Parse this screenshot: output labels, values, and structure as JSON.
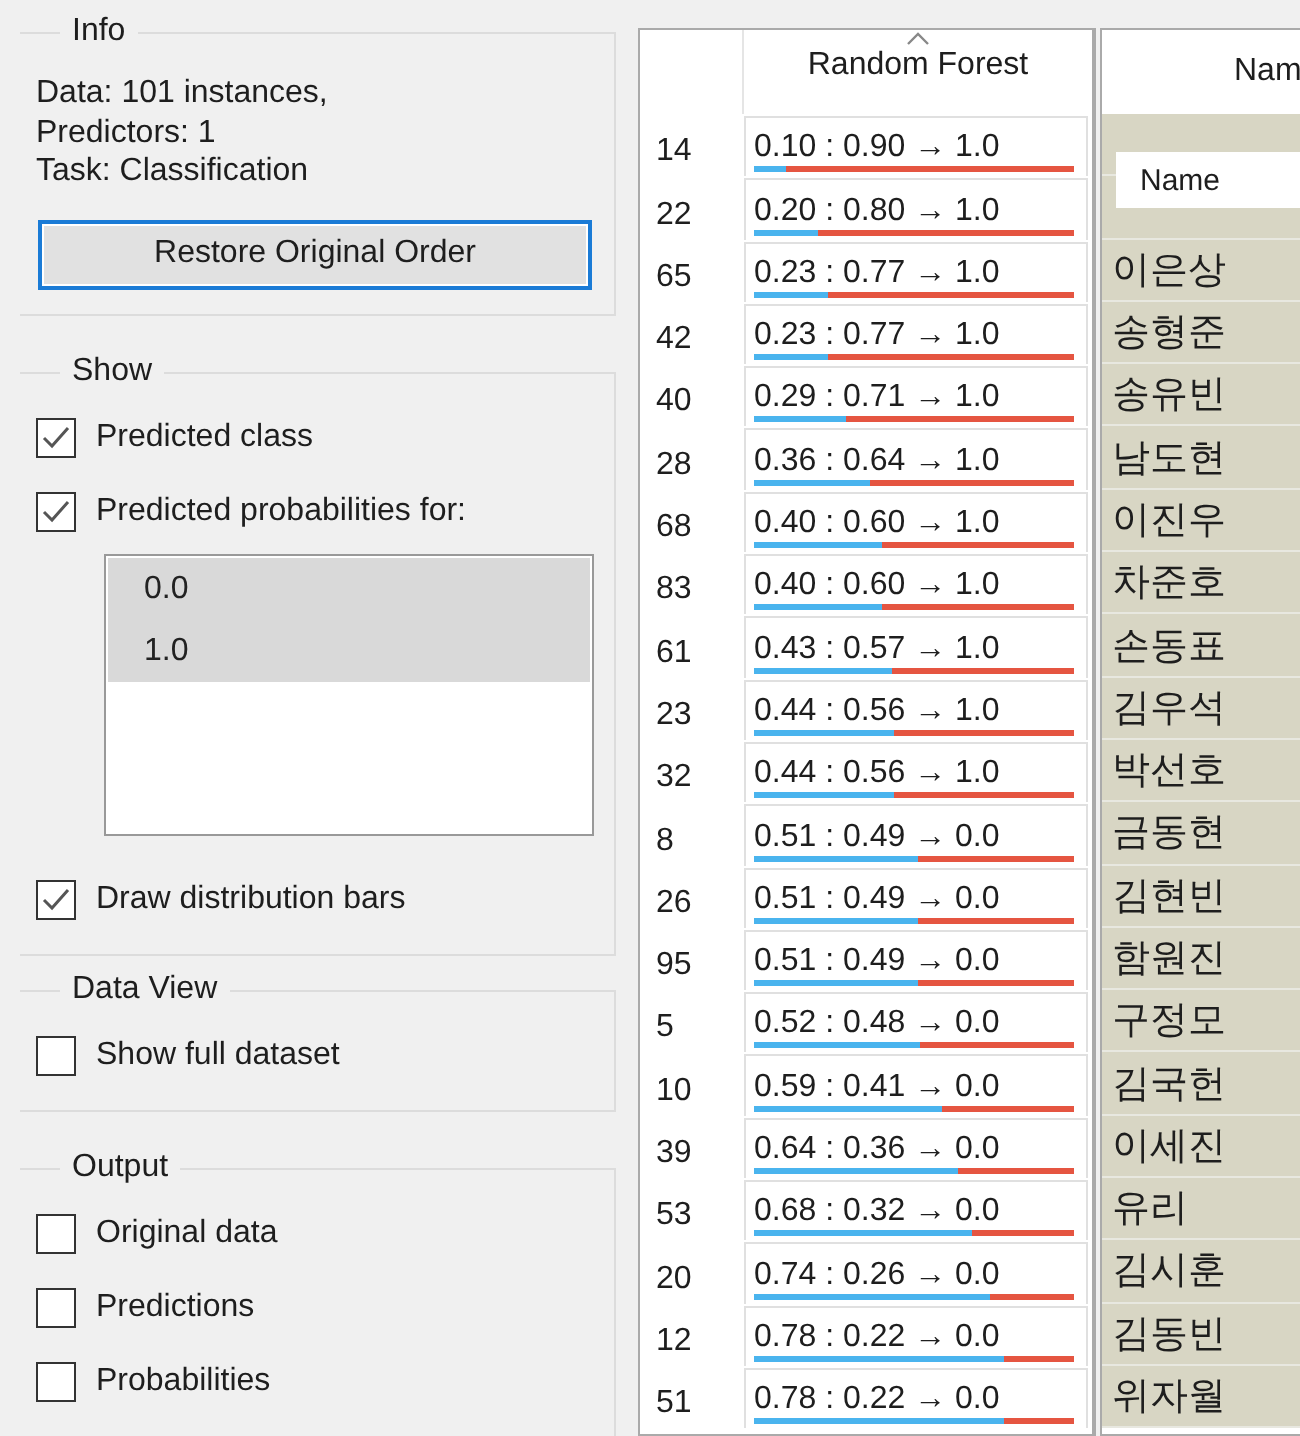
{
  "info": {
    "title": "Info",
    "lines": [
      "Data: 101 instances,",
      "Predictors: 1",
      "Task: Classification"
    ],
    "button": "Restore Original Order"
  },
  "show": {
    "title": "Show",
    "options": [
      {
        "label": "Predicted class",
        "checked": true
      },
      {
        "label": "Predicted probabilities for:",
        "checked": true
      }
    ],
    "classes": [
      {
        "label": "0.0",
        "selected": true
      },
      {
        "label": "1.0",
        "selected": true
      }
    ],
    "bars": {
      "label": "Draw distribution bars",
      "checked": true
    }
  },
  "data_view": {
    "title": "Data View",
    "options": [
      {
        "label": "Show full dataset",
        "checked": false
      }
    ]
  },
  "output": {
    "title": "Output",
    "options": [
      {
        "label": "Original data",
        "checked": false
      },
      {
        "label": "Predictions",
        "checked": false
      },
      {
        "label": "Probabilities",
        "checked": false
      }
    ]
  },
  "table": {
    "columns": [
      "Random Forest",
      "Nam"
    ],
    "tooltip": "Name",
    "rows": [
      {
        "index": "14",
        "prediction": "0.10 : 0.90 → 1.0",
        "level": 0.1
      },
      {
        "index": "22",
        "prediction": "0.20 : 0.80 → 1.0",
        "level": 0.2
      },
      {
        "index": "65",
        "prediction": "0.23 : 0.77 → 1.0",
        "level": 0.23,
        "name": "이은상"
      },
      {
        "index": "42",
        "prediction": "0.23 : 0.77 → 1.0",
        "level": 0.23,
        "name": "송형준"
      },
      {
        "index": "40",
        "prediction": "0.29 : 0.71 → 1.0",
        "level": 0.29,
        "name": "송유빈"
      },
      {
        "index": "28",
        "prediction": "0.36 : 0.64 → 1.0",
        "level": 0.36,
        "name": "남도현"
      },
      {
        "index": "68",
        "prediction": "0.40 : 0.60 → 1.0",
        "level": 0.4,
        "name": "이진우"
      },
      {
        "index": "83",
        "prediction": "0.40 : 0.60 → 1.0",
        "level": 0.4,
        "name": "차준호"
      },
      {
        "index": "61",
        "prediction": "0.43 : 0.57 → 1.0",
        "level": 0.43,
        "name": "손동표"
      },
      {
        "index": "23",
        "prediction": "0.44 : 0.56 → 1.0",
        "level": 0.44,
        "name": "김우석"
      },
      {
        "index": "32",
        "prediction": "0.44 : 0.56 → 1.0",
        "level": 0.44,
        "name": "박선호"
      },
      {
        "index": "8",
        "prediction": "0.51 : 0.49 → 0.0",
        "level": 0.51,
        "name": "금동현"
      },
      {
        "index": "26",
        "prediction": "0.51 : 0.49 → 0.0",
        "level": 0.51,
        "name": "김현빈"
      },
      {
        "index": "95",
        "prediction": "0.51 : 0.49 → 0.0",
        "level": 0.51,
        "name": "함원진"
      },
      {
        "index": "5",
        "prediction": "0.52 : 0.48 → 0.0",
        "level": 0.52,
        "name": "구정모"
      },
      {
        "index": "10",
        "prediction": "0.59 : 0.41 → 0.0",
        "level": 0.59,
        "name": "김국헌"
      },
      {
        "index": "39",
        "prediction": "0.64 : 0.36 → 0.0",
        "level": 0.64,
        "name": "이세진"
      },
      {
        "index": "53",
        "prediction": "0.68 : 0.32 → 0.0",
        "level": 0.68,
        "name": "유리"
      },
      {
        "index": "20",
        "prediction": "0.74 : 0.26 → 0.0",
        "level": 0.74,
        "name": "김시훈"
      },
      {
        "index": "12",
        "prediction": "0.78 : 0.22 → 0.0",
        "level": 0.78,
        "name": "김동빈"
      },
      {
        "index": "51",
        "prediction": "0.78 : 0.22 → 0.0",
        "level": 0.78,
        "name": "위자월"
      }
    ]
  }
}
